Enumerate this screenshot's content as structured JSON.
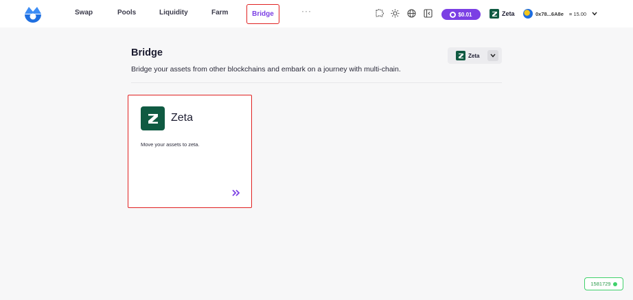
{
  "header": {
    "nav": [
      "Swap",
      "Pools",
      "Liquidity",
      "Farm"
    ],
    "nav_active": "Bridge",
    "more": "···",
    "price": "$0.01",
    "chain": "Zeta",
    "account": "0x78...6A8e",
    "balance": "≡ 15.00"
  },
  "page": {
    "title": "Bridge",
    "subtitle": "Bridge your assets from other blockchains and embark on a journey with multi-chain.",
    "network_select": "Zeta"
  },
  "card": {
    "name": "Zeta",
    "description": "Move your assets to zeta."
  },
  "status": {
    "block": "1581729"
  },
  "colors": {
    "accent": "#7b3fe4",
    "zeta_green": "#0f5a42",
    "highlight_red": "#e02020",
    "status_green": "#3fd16a"
  }
}
